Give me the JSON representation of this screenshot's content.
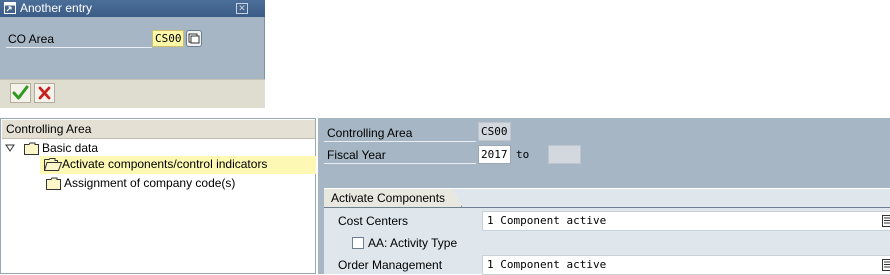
{
  "popup": {
    "title": "Another entry",
    "field_label": "CO Area",
    "field_value": "CS00",
    "confirm_icon": "check-icon",
    "cancel_icon": "cancel-icon"
  },
  "tree": {
    "header": "Controlling Area",
    "nodes": [
      {
        "label": "Basic data",
        "expanded": true
      },
      {
        "label": "Activate components/control indicators",
        "selected": true
      },
      {
        "label": "Assignment of company code(s)"
      }
    ]
  },
  "detail": {
    "controlling_area_label": "Controlling Area",
    "controlling_area_value": "CS00",
    "fiscal_year_label": "Fiscal Year",
    "fiscal_year_from": "2017",
    "to_label": "to",
    "fiscal_year_to": "",
    "tab_label": "Activate Components",
    "components": [
      {
        "label": "Cost Centers",
        "value": "1 Component active"
      },
      {
        "label": "AA: Activity Type",
        "checked": false
      },
      {
        "label": "Order Management",
        "value": "1 Component active"
      }
    ]
  },
  "colors": {
    "titlebar": "#3f6290",
    "panel": "#a6b6c4",
    "input_highlight": "#fdf8a8",
    "selection": "#fdf8b4"
  }
}
